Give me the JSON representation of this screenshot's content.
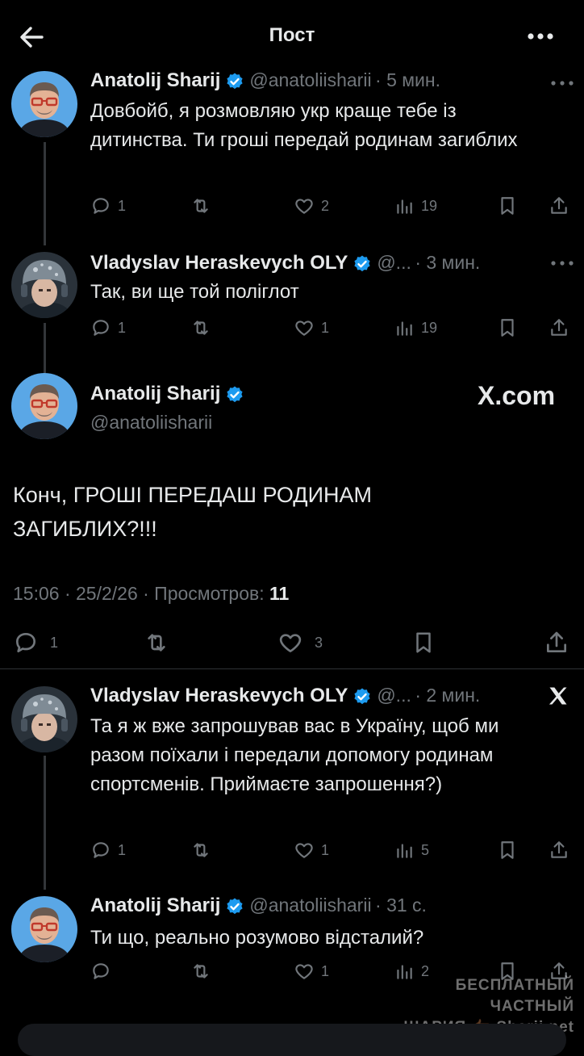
{
  "header": {
    "title": "Пост"
  },
  "colors": {
    "background": "#000000",
    "text": "#e7e9ea",
    "muted": "#71767b",
    "verified": "#1d9bf0",
    "divider": "#2f3336"
  },
  "posts": [
    {
      "name": "Anatolij Sharij",
      "handle": "@anatoliisharii",
      "time": "· 5 мин.",
      "text": "Довбойб, я розмовляю укр краще тебе із дитинства. Ти гроші передай родинам загиблих",
      "replies": "1",
      "likes": "2",
      "views": "19"
    },
    {
      "name": "Vladyslav Heraskevych OLY",
      "handle": "@...",
      "time": "· 3 мин.",
      "text": "Так, ви ще той поліглот",
      "replies": "1",
      "likes": "1",
      "views": "19"
    }
  ],
  "main_post": {
    "name": "Anatolij Sharij",
    "handle": "@anatoliisharii",
    "badge": "X.com",
    "text": "Конч, ГРОШІ ПЕРЕДАШ РОДИНАМ ЗАГИБЛИХ?!!!",
    "timestamp": "15:06 · 25/2/26 · Просмотров:",
    "views": "11",
    "replies": "1",
    "likes": "3"
  },
  "replies": [
    {
      "name": "Vladyslav Heraskevych OLY",
      "handle": "@...",
      "time": "· 2 мин.",
      "text": "Та я ж вже запрошував вас в Україну, щоб ми разом поїхали і передали допомогу родинам спортсменів. Приймаєте запрошення?)",
      "replies": "1",
      "likes": "1",
      "views": "5"
    },
    {
      "name": "Anatolij Sharij",
      "handle": "@anatoliisharii",
      "time": "· 31 с.",
      "text": "Ти що, реально розумово відсталий?",
      "replies": "",
      "likes": "1",
      "views": "2"
    }
  ],
  "watermark": {
    "line1": "БЕСПЛАТНЫЙ ЧАСТНЫЙ",
    "line2": "ШАРИЯ 👉🏾 Sharij.net"
  },
  "icons": [
    "back-arrow-icon",
    "more-icon",
    "verified-icon",
    "reply-icon",
    "retweet-icon",
    "like-icon",
    "views-icon",
    "bookmark-icon",
    "share-icon",
    "x-logo-icon"
  ]
}
